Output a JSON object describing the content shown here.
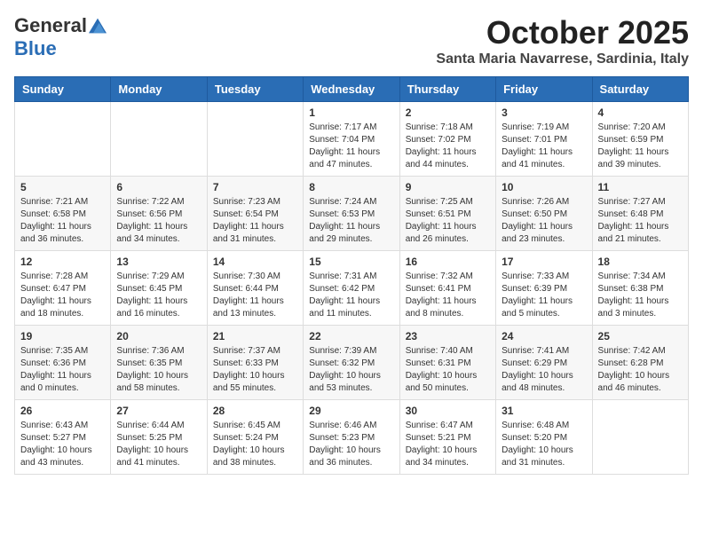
{
  "header": {
    "logo_general": "General",
    "logo_blue": "Blue",
    "month_title": "October 2025",
    "location": "Santa Maria Navarrese, Sardinia, Italy"
  },
  "weekdays": [
    "Sunday",
    "Monday",
    "Tuesday",
    "Wednesday",
    "Thursday",
    "Friday",
    "Saturday"
  ],
  "weeks": [
    [
      {
        "day": "",
        "info": ""
      },
      {
        "day": "",
        "info": ""
      },
      {
        "day": "",
        "info": ""
      },
      {
        "day": "1",
        "info": "Sunrise: 7:17 AM\nSunset: 7:04 PM\nDaylight: 11 hours and 47 minutes."
      },
      {
        "day": "2",
        "info": "Sunrise: 7:18 AM\nSunset: 7:02 PM\nDaylight: 11 hours and 44 minutes."
      },
      {
        "day": "3",
        "info": "Sunrise: 7:19 AM\nSunset: 7:01 PM\nDaylight: 11 hours and 41 minutes."
      },
      {
        "day": "4",
        "info": "Sunrise: 7:20 AM\nSunset: 6:59 PM\nDaylight: 11 hours and 39 minutes."
      }
    ],
    [
      {
        "day": "5",
        "info": "Sunrise: 7:21 AM\nSunset: 6:58 PM\nDaylight: 11 hours and 36 minutes."
      },
      {
        "day": "6",
        "info": "Sunrise: 7:22 AM\nSunset: 6:56 PM\nDaylight: 11 hours and 34 minutes."
      },
      {
        "day": "7",
        "info": "Sunrise: 7:23 AM\nSunset: 6:54 PM\nDaylight: 11 hours and 31 minutes."
      },
      {
        "day": "8",
        "info": "Sunrise: 7:24 AM\nSunset: 6:53 PM\nDaylight: 11 hours and 29 minutes."
      },
      {
        "day": "9",
        "info": "Sunrise: 7:25 AM\nSunset: 6:51 PM\nDaylight: 11 hours and 26 minutes."
      },
      {
        "day": "10",
        "info": "Sunrise: 7:26 AM\nSunset: 6:50 PM\nDaylight: 11 hours and 23 minutes."
      },
      {
        "day": "11",
        "info": "Sunrise: 7:27 AM\nSunset: 6:48 PM\nDaylight: 11 hours and 21 minutes."
      }
    ],
    [
      {
        "day": "12",
        "info": "Sunrise: 7:28 AM\nSunset: 6:47 PM\nDaylight: 11 hours and 18 minutes."
      },
      {
        "day": "13",
        "info": "Sunrise: 7:29 AM\nSunset: 6:45 PM\nDaylight: 11 hours and 16 minutes."
      },
      {
        "day": "14",
        "info": "Sunrise: 7:30 AM\nSunset: 6:44 PM\nDaylight: 11 hours and 13 minutes."
      },
      {
        "day": "15",
        "info": "Sunrise: 7:31 AM\nSunset: 6:42 PM\nDaylight: 11 hours and 11 minutes."
      },
      {
        "day": "16",
        "info": "Sunrise: 7:32 AM\nSunset: 6:41 PM\nDaylight: 11 hours and 8 minutes."
      },
      {
        "day": "17",
        "info": "Sunrise: 7:33 AM\nSunset: 6:39 PM\nDaylight: 11 hours and 5 minutes."
      },
      {
        "day": "18",
        "info": "Sunrise: 7:34 AM\nSunset: 6:38 PM\nDaylight: 11 hours and 3 minutes."
      }
    ],
    [
      {
        "day": "19",
        "info": "Sunrise: 7:35 AM\nSunset: 6:36 PM\nDaylight: 11 hours and 0 minutes."
      },
      {
        "day": "20",
        "info": "Sunrise: 7:36 AM\nSunset: 6:35 PM\nDaylight: 10 hours and 58 minutes."
      },
      {
        "day": "21",
        "info": "Sunrise: 7:37 AM\nSunset: 6:33 PM\nDaylight: 10 hours and 55 minutes."
      },
      {
        "day": "22",
        "info": "Sunrise: 7:39 AM\nSunset: 6:32 PM\nDaylight: 10 hours and 53 minutes."
      },
      {
        "day": "23",
        "info": "Sunrise: 7:40 AM\nSunset: 6:31 PM\nDaylight: 10 hours and 50 minutes."
      },
      {
        "day": "24",
        "info": "Sunrise: 7:41 AM\nSunset: 6:29 PM\nDaylight: 10 hours and 48 minutes."
      },
      {
        "day": "25",
        "info": "Sunrise: 7:42 AM\nSunset: 6:28 PM\nDaylight: 10 hours and 46 minutes."
      }
    ],
    [
      {
        "day": "26",
        "info": "Sunrise: 6:43 AM\nSunset: 5:27 PM\nDaylight: 10 hours and 43 minutes."
      },
      {
        "day": "27",
        "info": "Sunrise: 6:44 AM\nSunset: 5:25 PM\nDaylight: 10 hours and 41 minutes."
      },
      {
        "day": "28",
        "info": "Sunrise: 6:45 AM\nSunset: 5:24 PM\nDaylight: 10 hours and 38 minutes."
      },
      {
        "day": "29",
        "info": "Sunrise: 6:46 AM\nSunset: 5:23 PM\nDaylight: 10 hours and 36 minutes."
      },
      {
        "day": "30",
        "info": "Sunrise: 6:47 AM\nSunset: 5:21 PM\nDaylight: 10 hours and 34 minutes."
      },
      {
        "day": "31",
        "info": "Sunrise: 6:48 AM\nSunset: 5:20 PM\nDaylight: 10 hours and 31 minutes."
      },
      {
        "day": "",
        "info": ""
      }
    ]
  ]
}
